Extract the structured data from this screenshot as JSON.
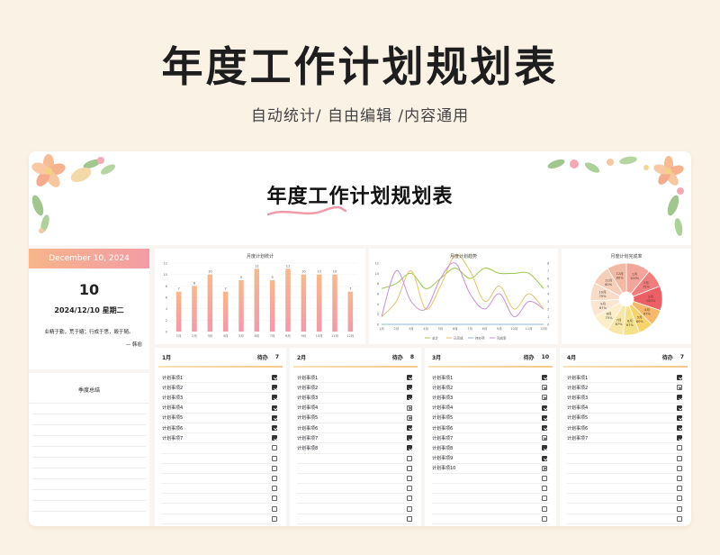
{
  "page": {
    "title": "年度工作计划规划表",
    "subtitle": "自动统计/ 自由编辑  /内容通用"
  },
  "sheet": {
    "title": "年度工作计划规划表"
  },
  "date_card": {
    "header": "December 10, 2024",
    "day": "10",
    "date_line": "2024/12/10  星期二",
    "quote": "业精于勤，荒于嬉；行成于思，毁于随。",
    "author": "— 韩愈"
  },
  "season": {
    "title": "季度总结"
  },
  "charts": {
    "bar_title": "月度计划统计",
    "line_title": "月度计划趋势",
    "pie_title": "月度计划完成率"
  },
  "chart_data": [
    {
      "type": "bar",
      "title": "月度计划统计",
      "categories": [
        "1月",
        "2月",
        "3月",
        "4月",
        "5月",
        "6月",
        "7月",
        "8月",
        "9月",
        "10月",
        "11月",
        "12月"
      ],
      "values": [
        7,
        8,
        10,
        7,
        9,
        11,
        9,
        11,
        10,
        10,
        10,
        7
      ],
      "ylim": [
        0,
        12
      ],
      "yticks": [
        0,
        2,
        4,
        6,
        8,
        10,
        12
      ],
      "colors": [
        "#f6b98c",
        "#f29aaa"
      ]
    },
    {
      "type": "line",
      "title": "月度计划趋势",
      "categories": [
        "1月",
        "2月",
        "3月",
        "4月",
        "5月",
        "6月",
        "7月",
        "8月",
        "9月",
        "10月",
        "11月",
        "12月"
      ],
      "ylim_left": [
        0,
        12
      ],
      "ylim_right": [
        0,
        8
      ],
      "yticks_left": [
        0,
        2,
        4,
        6,
        8,
        10,
        12
      ],
      "yticks_right": [
        0,
        1,
        2,
        3,
        4,
        5,
        6,
        7,
        8
      ],
      "series": [
        {
          "name": "总计",
          "color": "#9ac94a",
          "values": [
            7,
            8,
            10,
            7,
            9,
            11,
            9,
            11,
            10,
            10,
            10,
            7
          ]
        },
        {
          "name": "已完成",
          "color": "#e8c26a",
          "values": [
            1,
            3,
            7,
            2,
            5,
            9,
            7,
            3,
            5,
            2,
            4,
            2
          ]
        },
        {
          "name": "待办项",
          "color": "#8fb3d9",
          "values": [
            0,
            0,
            0,
            0,
            0,
            0,
            0,
            0,
            0,
            0,
            0,
            0
          ]
        },
        {
          "name": "完成率",
          "color": "#c98ee0",
          "values": [
            1,
            7,
            3,
            2,
            6,
            8,
            4,
            2,
            4,
            1,
            3,
            2
          ]
        }
      ],
      "legend": "bottom"
    },
    {
      "type": "pie",
      "title": "月度计划完成率",
      "slices": [
        {
          "label": "1月",
          "value": 100,
          "pct": "100%",
          "color": "#f4a59a"
        },
        {
          "label": "2月",
          "value": 75,
          "pct": "75%",
          "color": "#f07e7e"
        },
        {
          "label": "3月",
          "value": 100,
          "pct": "100%",
          "color": "#ec5f66"
        },
        {
          "label": "4月",
          "value": 67,
          "pct": "67%",
          "color": "#f6b86a"
        },
        {
          "label": "5月",
          "value": 60,
          "pct": "60%",
          "color": "#f8d26a"
        },
        {
          "label": "6月",
          "value": 67,
          "pct": "67%",
          "color": "#f5e08c"
        },
        {
          "label": "7月",
          "value": 67,
          "pct": "67%",
          "color": "#f8e7a8"
        },
        {
          "label": "8月",
          "value": 75,
          "pct": "75%",
          "color": "#fbeec8"
        },
        {
          "label": "9月",
          "value": 67,
          "pct": "67%",
          "color": "#fbe6d2"
        },
        {
          "label": "10月",
          "value": 75,
          "pct": "75%",
          "color": "#f8dcc8"
        },
        {
          "label": "11月",
          "value": 80,
          "pct": "80%",
          "color": "#f6cfbb"
        },
        {
          "label": "12月",
          "value": 80,
          "pct": "80%",
          "color": "#f2b9a4"
        }
      ]
    }
  ],
  "months": [
    {
      "name": "1月",
      "pending_label": "待办",
      "pending": "7",
      "tasks": [
        {
          "label": "计划事项1",
          "state": "checked"
        },
        {
          "label": "计划事项2",
          "state": "checked"
        },
        {
          "label": "计划事项3",
          "state": "checked"
        },
        {
          "label": "计划事项4",
          "state": "checked"
        },
        {
          "label": "计划事项5",
          "state": "checked"
        },
        {
          "label": "计划事项6",
          "state": "checked"
        },
        {
          "label": "计划事项7",
          "state": "checked"
        },
        {
          "label": "",
          "state": "empty"
        },
        {
          "label": "",
          "state": "empty"
        },
        {
          "label": "",
          "state": "empty"
        },
        {
          "label": "",
          "state": "empty"
        },
        {
          "label": "",
          "state": "empty"
        },
        {
          "label": "",
          "state": "empty"
        },
        {
          "label": "",
          "state": "empty"
        },
        {
          "label": "",
          "state": "empty"
        }
      ]
    },
    {
      "name": "2月",
      "pending_label": "待办",
      "pending": "8",
      "tasks": [
        {
          "label": "计划事项1",
          "state": "checked"
        },
        {
          "label": "计划事项2",
          "state": "checked"
        },
        {
          "label": "计划事项3",
          "state": "checked"
        },
        {
          "label": "计划事项4",
          "state": "crossed"
        },
        {
          "label": "计划事项5",
          "state": "crossed"
        },
        {
          "label": "计划事项6",
          "state": "checked"
        },
        {
          "label": "计划事项7",
          "state": "checked"
        },
        {
          "label": "计划事项8",
          "state": "checked"
        },
        {
          "label": "",
          "state": "empty"
        },
        {
          "label": "",
          "state": "empty"
        },
        {
          "label": "",
          "state": "empty"
        },
        {
          "label": "",
          "state": "empty"
        },
        {
          "label": "",
          "state": "empty"
        },
        {
          "label": "",
          "state": "empty"
        },
        {
          "label": "",
          "state": "empty"
        }
      ]
    },
    {
      "name": "3月",
      "pending_label": "待办",
      "pending": "10",
      "tasks": [
        {
          "label": "计划事项1",
          "state": "checked"
        },
        {
          "label": "计划事项2",
          "state": "crossed"
        },
        {
          "label": "计划事项3",
          "state": "crossed"
        },
        {
          "label": "计划事项4",
          "state": "checked"
        },
        {
          "label": "计划事项5",
          "state": "checked"
        },
        {
          "label": "计划事项6",
          "state": "checked"
        },
        {
          "label": "计划事项7",
          "state": "crossed"
        },
        {
          "label": "计划事项8",
          "state": "checked"
        },
        {
          "label": "计划事项9",
          "state": "checked"
        },
        {
          "label": "计划事项10",
          "state": "crossed"
        },
        {
          "label": "",
          "state": "empty"
        },
        {
          "label": "",
          "state": "empty"
        },
        {
          "label": "",
          "state": "empty"
        },
        {
          "label": "",
          "state": "empty"
        },
        {
          "label": "",
          "state": "empty"
        }
      ]
    },
    {
      "name": "4月",
      "pending_label": "待办",
      "pending": "7",
      "tasks": [
        {
          "label": "计划事项1",
          "state": "checked"
        },
        {
          "label": "计划事项2",
          "state": "crossed"
        },
        {
          "label": "计划事项3",
          "state": "checked"
        },
        {
          "label": "计划事项4",
          "state": "checked"
        },
        {
          "label": "计划事项5",
          "state": "checked"
        },
        {
          "label": "计划事项6",
          "state": "checked"
        },
        {
          "label": "计划事项7",
          "state": "checked"
        },
        {
          "label": "",
          "state": "empty"
        },
        {
          "label": "",
          "state": "empty"
        },
        {
          "label": "",
          "state": "empty"
        },
        {
          "label": "",
          "state": "empty"
        },
        {
          "label": "",
          "state": "empty"
        },
        {
          "label": "",
          "state": "empty"
        },
        {
          "label": "",
          "state": "empty"
        },
        {
          "label": "",
          "state": "empty"
        }
      ]
    }
  ]
}
